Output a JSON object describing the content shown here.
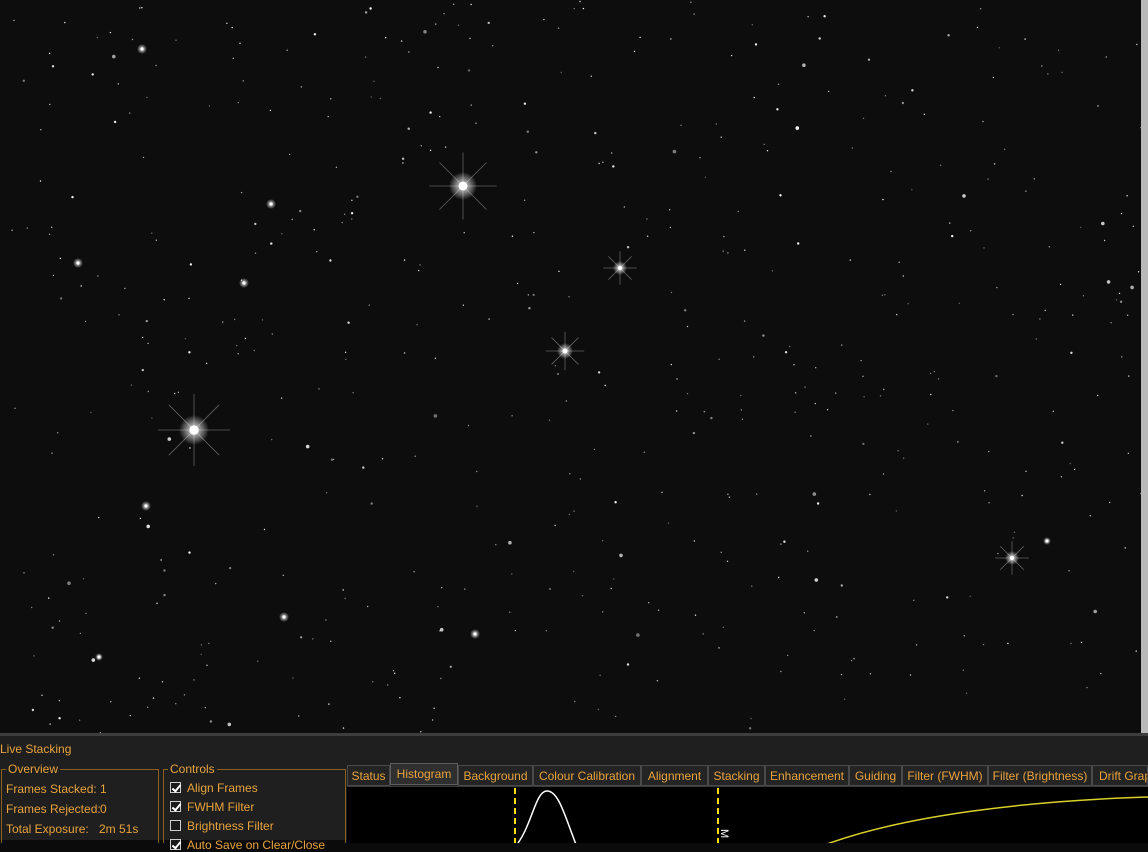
{
  "panel": {
    "title": "Live Stacking",
    "overview": {
      "title": "Overview",
      "frames_stacked_label": "Frames Stacked:",
      "frames_stacked_value": "1",
      "frames_rejected_label": "Frames Rejected:",
      "frames_rejected_value": "0",
      "total_exposure_label": "Total Exposure:",
      "total_exposure_value": "2m 51s"
    },
    "controls": {
      "title": "Controls",
      "items": [
        {
          "label": "Align Frames",
          "checked": true
        },
        {
          "label": "FWHM Filter",
          "checked": true
        },
        {
          "label": "Brightness Filter",
          "checked": false
        },
        {
          "label": "Auto Save on Clear/Close",
          "checked": true
        }
      ]
    },
    "tabs": [
      "Status",
      "Histogram",
      "Background",
      "Colour Calibration",
      "Alignment",
      "Stacking",
      "Enhancement",
      "Guiding",
      "Filter (FWHM)",
      "Filter (Brightness)",
      "Drift Graph"
    ],
    "active_tab": "Histogram",
    "histogram": {
      "marker_label": "M",
      "marker_color": "#ffe000",
      "curve_color": "#ffffff",
      "stretch_color": "#d9d02a"
    }
  }
}
